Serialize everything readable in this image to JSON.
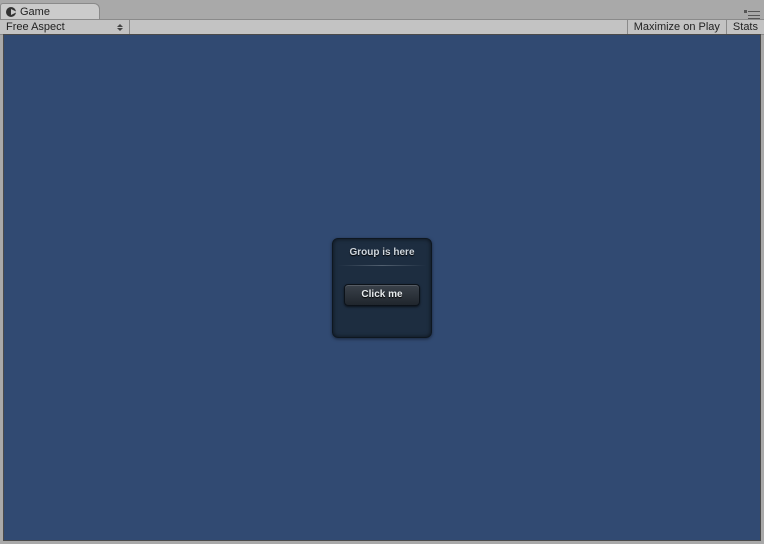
{
  "tab": {
    "label": "Game"
  },
  "toolbar": {
    "aspect_label": "Free Aspect",
    "maximize_label": "Maximize on Play",
    "stats_label": "Stats"
  },
  "scene": {
    "group_title": "Group is here",
    "button_label": "Click me"
  },
  "colors": {
    "viewport_bg": "#314a72"
  }
}
